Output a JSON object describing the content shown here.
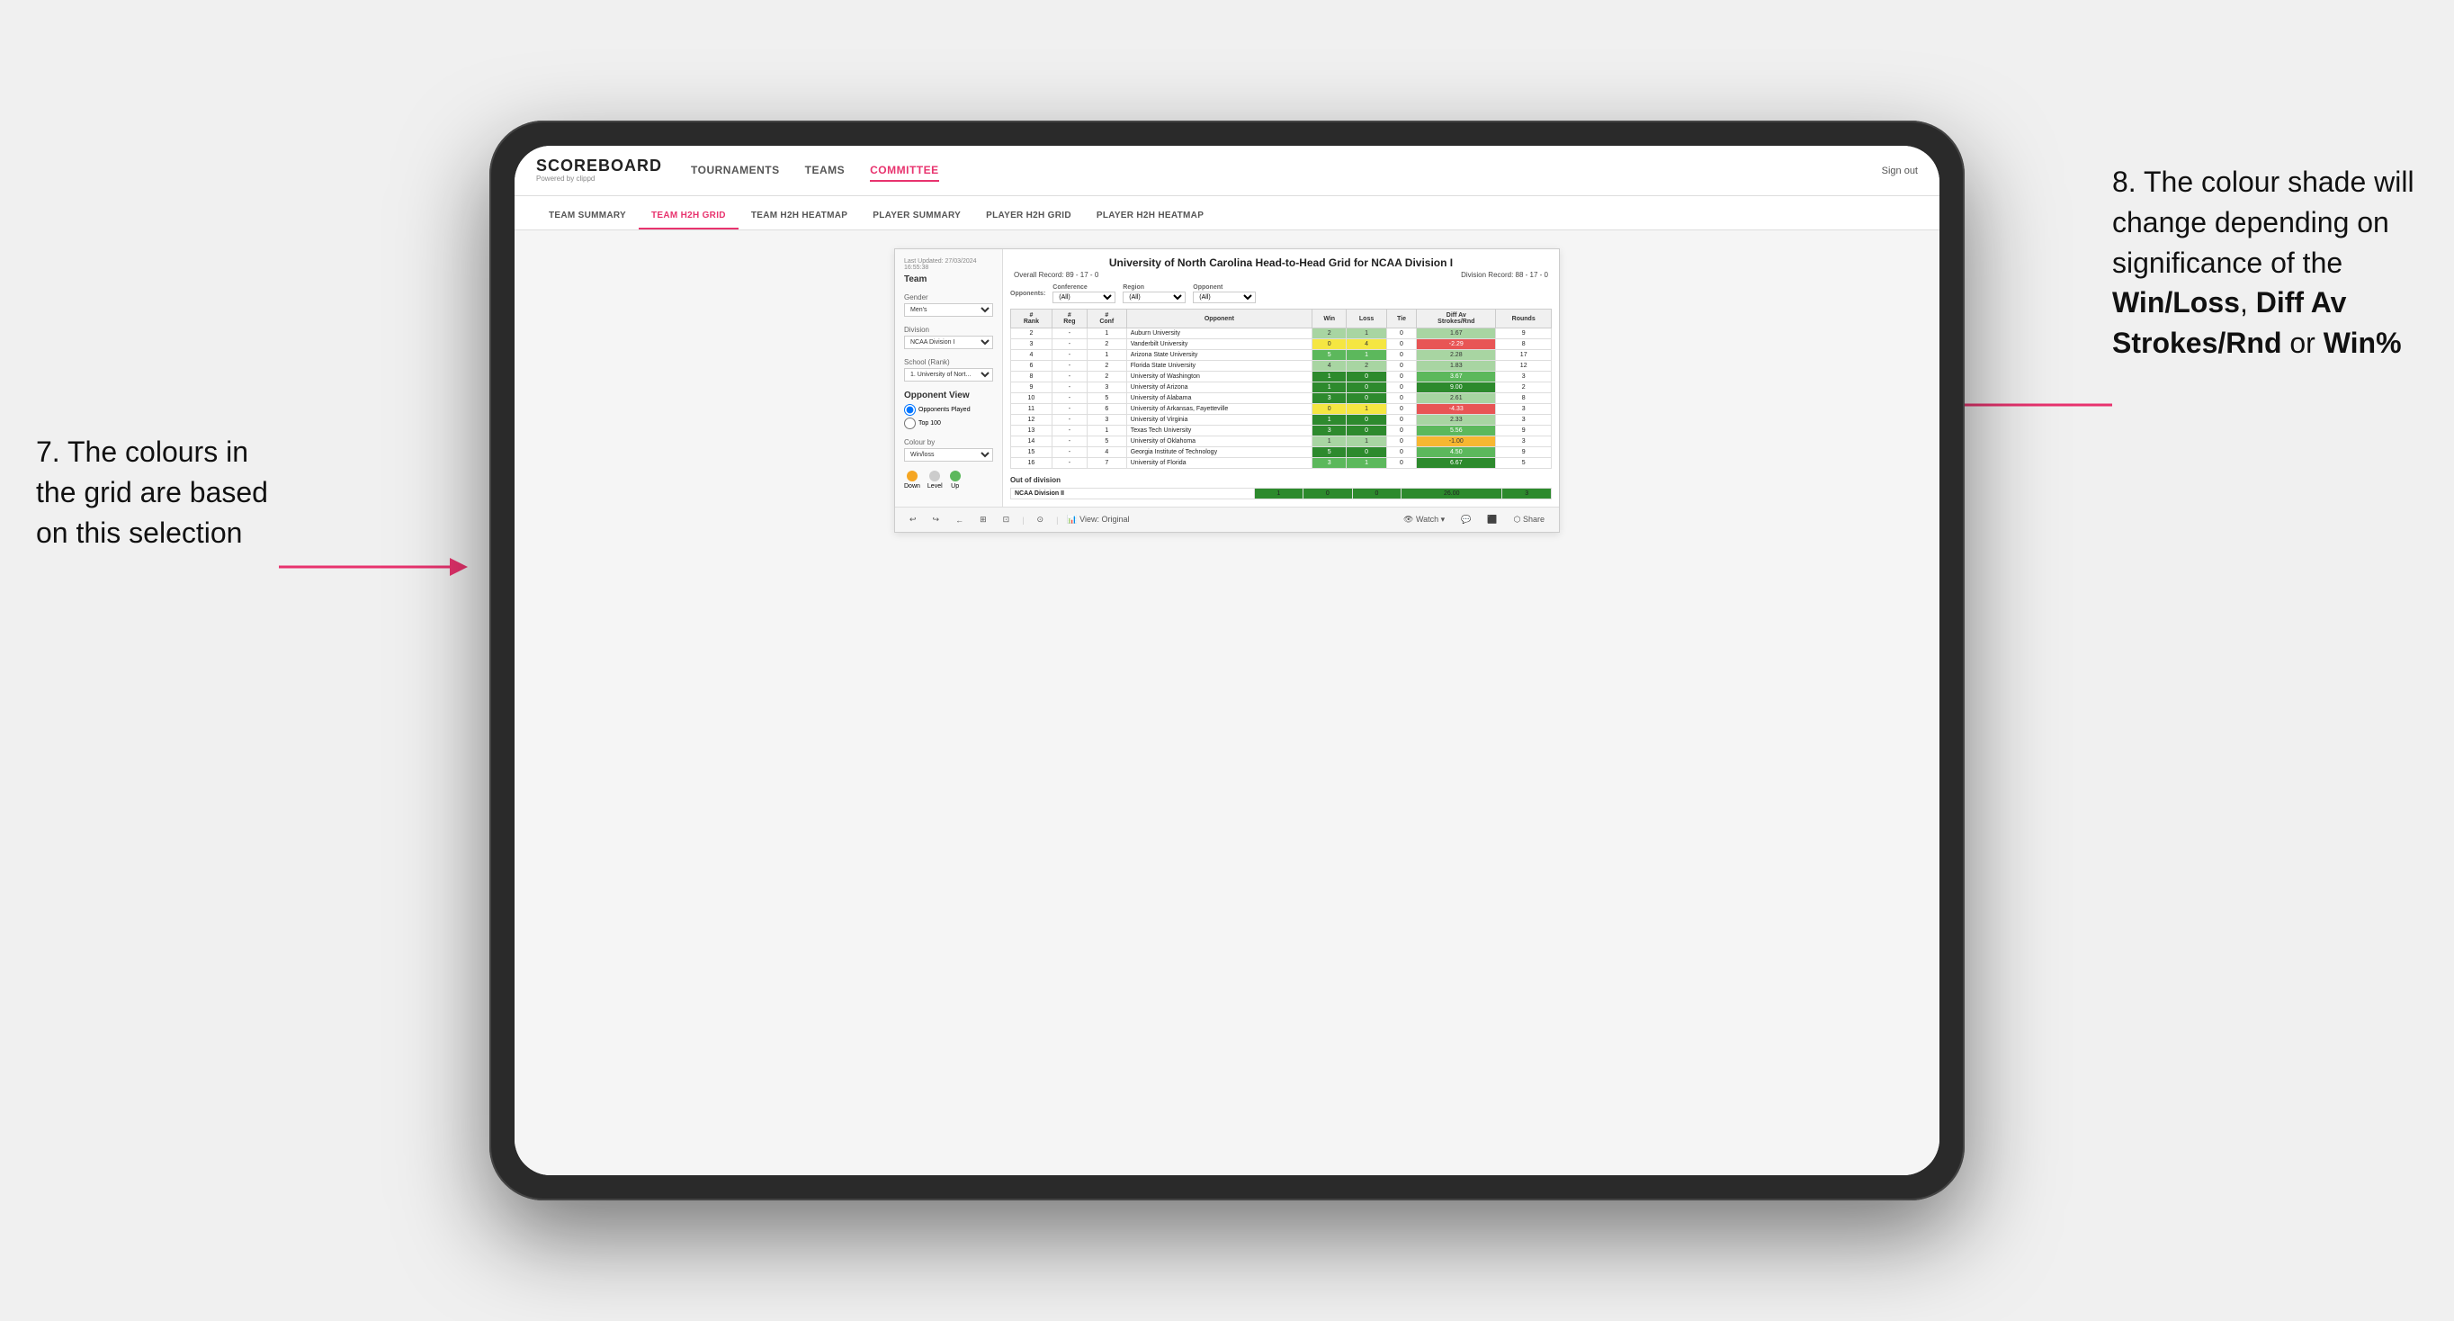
{
  "annotations": {
    "left_text": "7. The colours in the grid are based on this selection",
    "right_text_1": "8. The colour shade will change depending on significance of the ",
    "right_bold_1": "Win/Loss",
    "right_text_2": ", ",
    "right_bold_2": "Diff Av Strokes/Rnd",
    "right_text_3": " or ",
    "right_bold_3": "Win%"
  },
  "header": {
    "logo": "SCOREBOARD",
    "logo_sub": "Powered by clippd",
    "nav_items": [
      "TOURNAMENTS",
      "TEAMS",
      "COMMITTEE"
    ],
    "active_nav": "COMMITTEE",
    "sign_out": "Sign out"
  },
  "sub_nav": {
    "items": [
      "TEAM SUMMARY",
      "TEAM H2H GRID",
      "TEAM H2H HEATMAP",
      "PLAYER SUMMARY",
      "PLAYER H2H GRID",
      "PLAYER H2H HEATMAP"
    ],
    "active": "TEAM H2H GRID"
  },
  "viz": {
    "last_updated": "Last Updated: 27/03/2024 16:55:38",
    "title": "University of North Carolina Head-to-Head Grid for NCAA Division I",
    "overall_record": "Overall Record: 89 - 17 - 0",
    "division_record": "Division Record: 88 - 17 - 0",
    "sidebar": {
      "team_label": "Team",
      "gender_label": "Gender",
      "gender_value": "Men's",
      "division_label": "Division",
      "division_value": "NCAA Division I",
      "school_label": "School (Rank)",
      "school_value": "1. University of Nort...",
      "opponent_view_label": "Opponent View",
      "radio_options": [
        "Opponents Played",
        "Top 100"
      ],
      "colour_by_label": "Colour by",
      "colour_by_value": "Win/loss",
      "legend": [
        {
          "label": "Down",
          "color": "#f5a623"
        },
        {
          "label": "Level",
          "color": "#cccccc"
        },
        {
          "label": "Up",
          "color": "#5cb85c"
        }
      ]
    },
    "filters": {
      "opponents_label": "Opponents:",
      "conference_label": "Conference",
      "conference_value": "(All)",
      "region_label": "Region",
      "region_value": "(All)",
      "opponent_label": "Opponent",
      "opponent_value": "(All)"
    },
    "table_headers": [
      "#\nRank",
      "#\nReg",
      "#\nConf",
      "Opponent",
      "Win",
      "Loss",
      "Tie",
      "Diff Av\nStrokes/Rnd",
      "Rounds"
    ],
    "rows": [
      {
        "rank": "2",
        "reg": "-",
        "conf": "1",
        "opponent": "Auburn University",
        "win": "2",
        "loss": "1",
        "tie": "0",
        "diff": "1.67",
        "rounds": "9",
        "win_color": "green-light",
        "diff_color": "green-light"
      },
      {
        "rank": "3",
        "reg": "-",
        "conf": "2",
        "opponent": "Vanderbilt University",
        "win": "0",
        "loss": "4",
        "tie": "0",
        "diff": "-2.29",
        "rounds": "8",
        "win_color": "yellow",
        "diff_color": "red"
      },
      {
        "rank": "4",
        "reg": "-",
        "conf": "1",
        "opponent": "Arizona State University",
        "win": "5",
        "loss": "1",
        "tie": "0",
        "diff": "2.28",
        "rounds": "17",
        "win_color": "green-med",
        "diff_color": "green-light"
      },
      {
        "rank": "6",
        "reg": "-",
        "conf": "2",
        "opponent": "Florida State University",
        "win": "4",
        "loss": "2",
        "tie": "0",
        "diff": "1.83",
        "rounds": "12",
        "win_color": "green-light",
        "diff_color": "green-light"
      },
      {
        "rank": "8",
        "reg": "-",
        "conf": "2",
        "opponent": "University of Washington",
        "win": "1",
        "loss": "0",
        "tie": "0",
        "diff": "3.67",
        "rounds": "3",
        "win_color": "green-dark",
        "diff_color": "green-med"
      },
      {
        "rank": "9",
        "reg": "-",
        "conf": "3",
        "opponent": "University of Arizona",
        "win": "1",
        "loss": "0",
        "tie": "0",
        "diff": "9.00",
        "rounds": "2",
        "win_color": "green-dark",
        "diff_color": "green-dark"
      },
      {
        "rank": "10",
        "reg": "-",
        "conf": "5",
        "opponent": "University of Alabama",
        "win": "3",
        "loss": "0",
        "tie": "0",
        "diff": "2.61",
        "rounds": "8",
        "win_color": "green-dark",
        "diff_color": "green-light"
      },
      {
        "rank": "11",
        "reg": "-",
        "conf": "6",
        "opponent": "University of Arkansas, Fayetteville",
        "win": "0",
        "loss": "1",
        "tie": "0",
        "diff": "-4.33",
        "rounds": "3",
        "win_color": "yellow",
        "diff_color": "red"
      },
      {
        "rank": "12",
        "reg": "-",
        "conf": "3",
        "opponent": "University of Virginia",
        "win": "1",
        "loss": "0",
        "tie": "0",
        "diff": "2.33",
        "rounds": "3",
        "win_color": "green-dark",
        "diff_color": "green-light"
      },
      {
        "rank": "13",
        "reg": "-",
        "conf": "1",
        "opponent": "Texas Tech University",
        "win": "3",
        "loss": "0",
        "tie": "0",
        "diff": "5.56",
        "rounds": "9",
        "win_color": "green-dark",
        "diff_color": "green-med"
      },
      {
        "rank": "14",
        "reg": "-",
        "conf": "5",
        "opponent": "University of Oklahoma",
        "win": "1",
        "loss": "1",
        "tie": "0",
        "diff": "-1.00",
        "rounds": "3",
        "win_color": "green-light",
        "diff_color": "orange-light"
      },
      {
        "rank": "15",
        "reg": "-",
        "conf": "4",
        "opponent": "Georgia Institute of Technology",
        "win": "5",
        "loss": "0",
        "tie": "0",
        "diff": "4.50",
        "rounds": "9",
        "win_color": "green-dark",
        "diff_color": "green-med"
      },
      {
        "rank": "16",
        "reg": "-",
        "conf": "7",
        "opponent": "University of Florida",
        "win": "3",
        "loss": "1",
        "tie": "0",
        "diff": "6.67",
        "rounds": "5",
        "win_color": "green-med",
        "diff_color": "green-dark"
      }
    ],
    "out_of_division": {
      "label": "Out of division",
      "division": "NCAA Division II",
      "win": "1",
      "loss": "0",
      "tie": "0",
      "diff": "26.00",
      "rounds": "3"
    },
    "toolbar": {
      "view_label": "View: Original",
      "watch_label": "Watch",
      "share_label": "Share"
    }
  }
}
